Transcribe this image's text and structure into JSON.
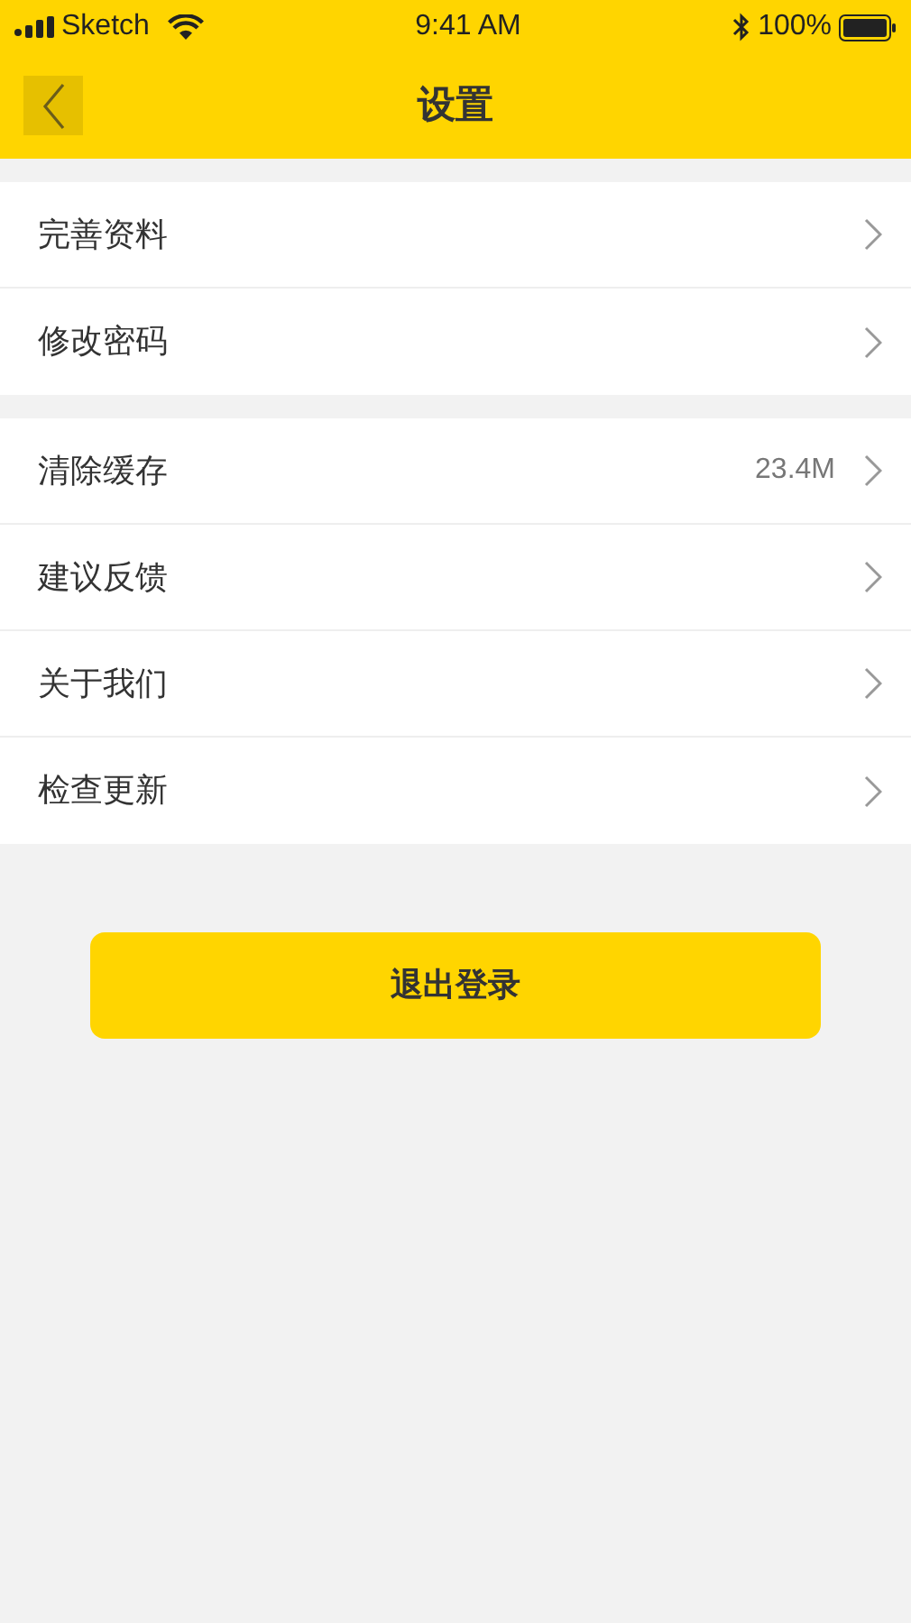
{
  "status_bar": {
    "carrier": "Sketch",
    "time": "9:41 AM",
    "battery": "100%"
  },
  "header": {
    "title": "设置"
  },
  "groups": [
    {
      "items": [
        {
          "label": "完善资料"
        },
        {
          "label": "修改密码"
        }
      ]
    },
    {
      "items": [
        {
          "label": "清除缓存",
          "value": "23.4M"
        },
        {
          "label": "建议反馈"
        },
        {
          "label": "关于我们"
        },
        {
          "label": "检查更新"
        }
      ]
    }
  ],
  "logout_button": "退出登录"
}
